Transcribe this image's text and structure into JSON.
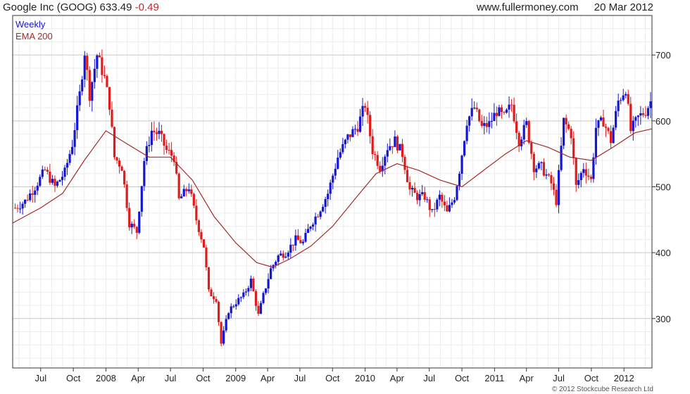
{
  "header": {
    "title": "Google Inc (GOOG)",
    "price": "633.49",
    "change": "-0.49",
    "website": "www.fullermoney.com",
    "date": "20 Mar 2012"
  },
  "legend": {
    "series1": "Weekly",
    "series2": "EMA 200"
  },
  "footer": {
    "copyright": "© 2012 Stockcube Research Ltd"
  },
  "colors": {
    "up": "#1515d4",
    "down": "#e01b1b",
    "ema": "#a52a2a",
    "grid": "#dcdcdc",
    "frame": "#333333"
  },
  "chart_data": {
    "type": "line",
    "ylim": [
      225,
      760
    ],
    "y_ticks": [
      300,
      400,
      500,
      600,
      700
    ],
    "x_ticks": [
      {
        "label": "Jul",
        "x": "2007-07-01"
      },
      {
        "label": "Oct",
        "x": "2007-10-01"
      },
      {
        "label": "2008",
        "x": "2008-01-01"
      },
      {
        "label": "Apr",
        "x": "2008-04-01"
      },
      {
        "label": "Jul",
        "x": "2008-07-01"
      },
      {
        "label": "Oct",
        "x": "2008-10-01"
      },
      {
        "label": "2009",
        "x": "2009-01-01"
      },
      {
        "label": "Apr",
        "x": "2009-04-01"
      },
      {
        "label": "Jul",
        "x": "2009-07-01"
      },
      {
        "label": "Oct",
        "x": "2009-10-01"
      },
      {
        "label": "2010",
        "x": "2010-01-01"
      },
      {
        "label": "Apr",
        "x": "2010-04-01"
      },
      {
        "label": "Jul",
        "x": "2010-07-01"
      },
      {
        "label": "Oct",
        "x": "2010-10-01"
      },
      {
        "label": "2011",
        "x": "2011-01-01"
      },
      {
        "label": "Apr",
        "x": "2011-04-01"
      },
      {
        "label": "Jul",
        "x": "2011-07-01"
      },
      {
        "label": "Oct",
        "x": "2011-10-01"
      },
      {
        "label": "2012",
        "x": "2012-01-01"
      }
    ],
    "x_range": [
      "2007-04-13",
      "2012-03-20"
    ],
    "grid": true,
    "legend_position": "top-left",
    "series": [
      {
        "name": "Weekly",
        "style": "candlestick (blue = up week, red = down week)",
        "values": [
          [
            "2007-04-20",
            468
          ],
          [
            "2007-05-18",
            478
          ],
          [
            "2007-06-15",
            500
          ],
          [
            "2007-07-13",
            525
          ],
          [
            "2007-08-10",
            500
          ],
          [
            "2007-09-07",
            522
          ],
          [
            "2007-09-28",
            565
          ],
          [
            "2007-10-19",
            640
          ],
          [
            "2007-11-02",
            705
          ],
          [
            "2007-11-16",
            640
          ],
          [
            "2007-12-07",
            700
          ],
          [
            "2007-12-28",
            665
          ],
          [
            "2008-01-11",
            625
          ],
          [
            "2008-01-25",
            545
          ],
          [
            "2008-02-15",
            530
          ],
          [
            "2008-03-07",
            445
          ],
          [
            "2008-03-28",
            432
          ],
          [
            "2008-04-18",
            540
          ],
          [
            "2008-05-09",
            585
          ],
          [
            "2008-05-30",
            580
          ],
          [
            "2008-06-20",
            555
          ],
          [
            "2008-07-11",
            545
          ],
          [
            "2008-07-25",
            480
          ],
          [
            "2008-08-22",
            500
          ],
          [
            "2008-09-12",
            450
          ],
          [
            "2008-10-03",
            410
          ],
          [
            "2008-10-17",
            340
          ],
          [
            "2008-11-07",
            330
          ],
          [
            "2008-11-21",
            262
          ],
          [
            "2008-12-12",
            312
          ],
          [
            "2009-01-02",
            325
          ],
          [
            "2009-01-23",
            335
          ],
          [
            "2009-02-13",
            358
          ],
          [
            "2009-03-06",
            305
          ],
          [
            "2009-03-20",
            335
          ],
          [
            "2009-04-10",
            375
          ],
          [
            "2009-05-01",
            395
          ],
          [
            "2009-05-22",
            400
          ],
          [
            "2009-06-19",
            420
          ],
          [
            "2009-07-10",
            415
          ],
          [
            "2009-07-31",
            443
          ],
          [
            "2009-08-21",
            460
          ],
          [
            "2009-09-18",
            490
          ],
          [
            "2009-10-16",
            545
          ],
          [
            "2009-11-13",
            575
          ],
          [
            "2009-12-11",
            592
          ],
          [
            "2010-01-01",
            625
          ],
          [
            "2010-01-22",
            555
          ],
          [
            "2010-02-12",
            530
          ],
          [
            "2010-03-05",
            560
          ],
          [
            "2010-03-26",
            570
          ],
          [
            "2010-04-16",
            550
          ],
          [
            "2010-05-07",
            495
          ],
          [
            "2010-05-28",
            485
          ],
          [
            "2010-06-18",
            485
          ],
          [
            "2010-07-09",
            460
          ],
          [
            "2010-07-30",
            485
          ],
          [
            "2010-08-20",
            460
          ],
          [
            "2010-09-10",
            485
          ],
          [
            "2010-09-24",
            525
          ],
          [
            "2010-10-15",
            600
          ],
          [
            "2010-11-05",
            620
          ],
          [
            "2010-11-26",
            590
          ],
          [
            "2010-12-17",
            595
          ],
          [
            "2011-01-07",
            615
          ],
          [
            "2011-01-28",
            605
          ],
          [
            "2011-02-18",
            625
          ],
          [
            "2011-03-11",
            570
          ],
          [
            "2011-04-01",
            595
          ],
          [
            "2011-04-22",
            530
          ],
          [
            "2011-05-13",
            530
          ],
          [
            "2011-06-10",
            505
          ],
          [
            "2011-06-24",
            478
          ],
          [
            "2011-07-15",
            600
          ],
          [
            "2011-08-05",
            580
          ],
          [
            "2011-08-19",
            500
          ],
          [
            "2011-09-09",
            530
          ],
          [
            "2011-09-30",
            510
          ],
          [
            "2011-10-14",
            590
          ],
          [
            "2011-11-04",
            600
          ],
          [
            "2011-11-25",
            570
          ],
          [
            "2011-12-16",
            630
          ],
          [
            "2012-01-06",
            650
          ],
          [
            "2012-01-20",
            585
          ],
          [
            "2012-02-10",
            605
          ],
          [
            "2012-03-02",
            615
          ],
          [
            "2012-03-20",
            633.49
          ]
        ]
      },
      {
        "name": "EMA 200",
        "style": "line",
        "values": [
          [
            "2007-04-13",
            445
          ],
          [
            "2007-07-01",
            468
          ],
          [
            "2007-09-01",
            490
          ],
          [
            "2007-11-01",
            540
          ],
          [
            "2008-01-01",
            585
          ],
          [
            "2008-03-01",
            565
          ],
          [
            "2008-05-01",
            545
          ],
          [
            "2008-07-01",
            545
          ],
          [
            "2008-09-01",
            510
          ],
          [
            "2008-11-01",
            455
          ],
          [
            "2009-01-01",
            415
          ],
          [
            "2009-03-01",
            385
          ],
          [
            "2009-04-15",
            378
          ],
          [
            "2009-06-01",
            390
          ],
          [
            "2009-08-01",
            410
          ],
          [
            "2009-10-01",
            440
          ],
          [
            "2009-12-01",
            480
          ],
          [
            "2010-02-01",
            520
          ],
          [
            "2010-04-01",
            535
          ],
          [
            "2010-06-01",
            525
          ],
          [
            "2010-08-01",
            510
          ],
          [
            "2010-10-01",
            500
          ],
          [
            "2010-12-01",
            525
          ],
          [
            "2011-02-01",
            550
          ],
          [
            "2011-04-01",
            570
          ],
          [
            "2011-06-01",
            560
          ],
          [
            "2011-08-01",
            545
          ],
          [
            "2011-10-01",
            540
          ],
          [
            "2011-12-01",
            560
          ],
          [
            "2012-02-01",
            582
          ],
          [
            "2012-03-20",
            588
          ]
        ]
      }
    ]
  }
}
